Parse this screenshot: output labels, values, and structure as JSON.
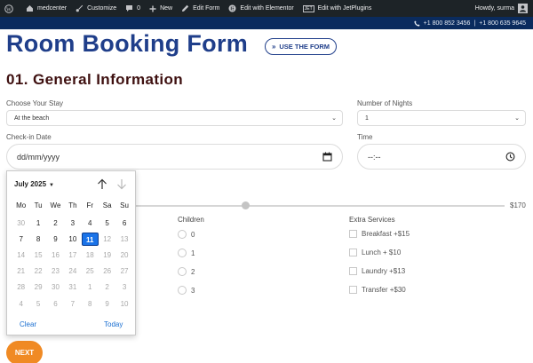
{
  "adminbar": {
    "site": "medcenter",
    "customize": "Customize",
    "comments_count": "0",
    "new": "New",
    "edit_form": "Edit Form",
    "edit_elementor": "Edit with Elementor",
    "edit_jet": "Edit with JetPlugins",
    "jet_badge": "JET",
    "howdy": "Howdy, surma"
  },
  "topbar": {
    "phone1": "+1 800 852 3456",
    "separator": "|",
    "phone2": "+1 800 635 9645"
  },
  "page": {
    "title": "Room Booking Form",
    "use_form": "USE THE FORM",
    "use_form_icon": "»"
  },
  "section": {
    "title": "01. General Information"
  },
  "fields": {
    "stay_label": "Choose Your Stay",
    "stay_value": "At the beach",
    "nights_label": "Number of Nights",
    "nights_value": "1",
    "checkin_label": "Check-in Date",
    "checkin_placeholder": "dd/mm/yyyy",
    "time_label": "Time",
    "time_placeholder": "--:--",
    "price_max": "$170"
  },
  "children": {
    "title": "Children",
    "options": [
      "0",
      "1",
      "2",
      "3"
    ]
  },
  "services": {
    "title": "Extra Services",
    "options": [
      "Breakfast +$15",
      "Lunch + $10",
      "Laundry +$13",
      "Transfer +$30"
    ]
  },
  "next_label": "NEXT",
  "datepicker": {
    "month": "July 2025",
    "weekdays": [
      "Mo",
      "Tu",
      "We",
      "Th",
      "Fr",
      "Sa",
      "Su"
    ],
    "weeks": [
      [
        "30",
        "1",
        "2",
        "3",
        "4",
        "5",
        "6"
      ],
      [
        "7",
        "8",
        "9",
        "10",
        "11",
        "12",
        "13"
      ],
      [
        "14",
        "15",
        "16",
        "17",
        "18",
        "19",
        "20"
      ],
      [
        "21",
        "22",
        "23",
        "24",
        "25",
        "26",
        "27"
      ],
      [
        "28",
        "29",
        "30",
        "31",
        "1",
        "2",
        "3"
      ],
      [
        "4",
        "5",
        "6",
        "7",
        "8",
        "9",
        "10"
      ]
    ],
    "selected": "11",
    "clear": "Clear",
    "today": "Today"
  },
  "colors": {
    "brand": "#1f3e8a",
    "section": "#3e1010",
    "accent": "#f08a24",
    "selected": "#1a73e8"
  }
}
